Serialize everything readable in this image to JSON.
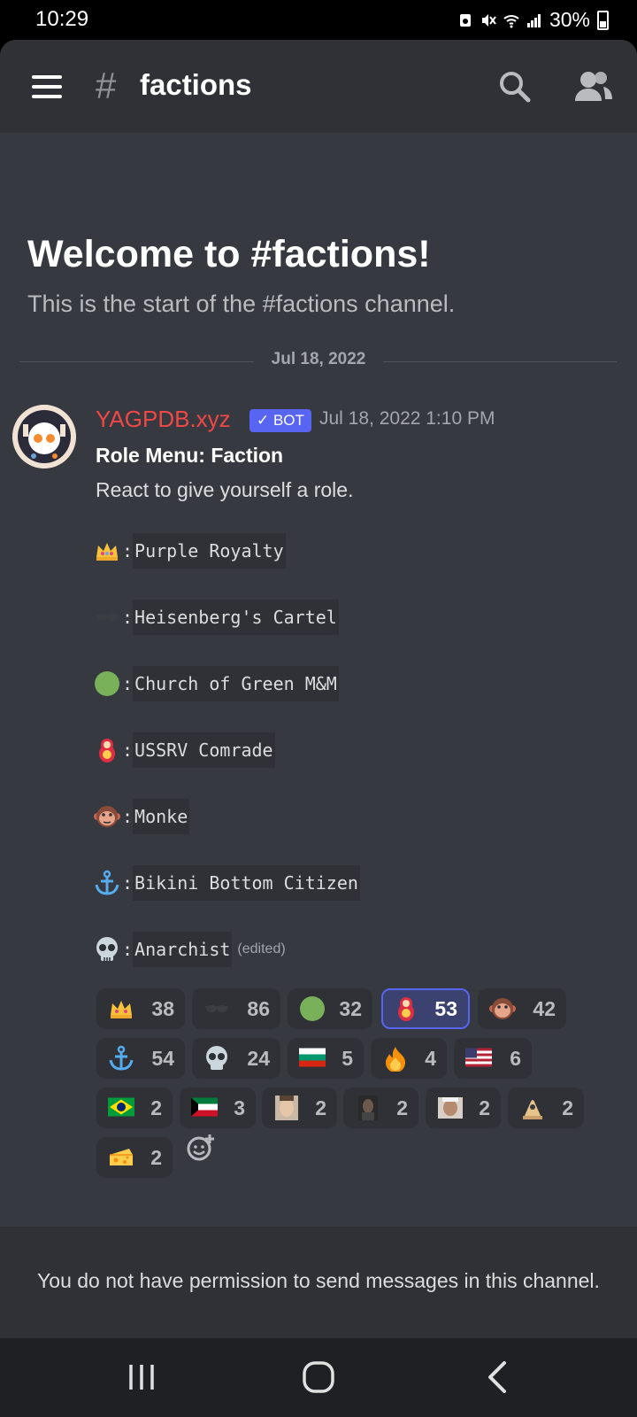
{
  "status": {
    "time": "10:29",
    "battery": "30%"
  },
  "header": {
    "hash": "#",
    "channel": "factions"
  },
  "welcome": {
    "title": "Welcome to #factions!",
    "subtitle": "This is the start of the #factions channel."
  },
  "date_divider": "Jul 18, 2022",
  "message": {
    "author": "YAGPDB.xyz",
    "bot_tag": "✓ BOT",
    "timestamp": "Jul 18, 2022 1:10 PM",
    "title": "Role Menu: Faction",
    "subtitle": "React to give yourself a role.",
    "colon": ":",
    "roles": [
      {
        "emoji": "crown-icon",
        "name": "Purple Royalty"
      },
      {
        "emoji": "sunglasses-icon",
        "name": "Heisenberg's Cartel"
      },
      {
        "emoji": "green-circle-icon",
        "name": "Church of Green M&M"
      },
      {
        "emoji": "nesting-doll-icon",
        "name": "USSRV Comrade"
      },
      {
        "emoji": "monkey-face-icon",
        "name": "Monke"
      },
      {
        "emoji": "anchor-icon",
        "name": "Bikini Bottom Citizen"
      },
      {
        "emoji": "skull-icon",
        "name": "Anarchist"
      }
    ],
    "edited": "(edited)"
  },
  "reactions": [
    {
      "emoji": "crown-icon",
      "count": "38",
      "selected": false
    },
    {
      "emoji": "sunglasses-icon",
      "count": "86",
      "selected": false
    },
    {
      "emoji": "green-circle-icon",
      "count": "32",
      "selected": false
    },
    {
      "emoji": "nesting-doll-icon",
      "count": "53",
      "selected": true
    },
    {
      "emoji": "monkey-face-icon",
      "count": "42",
      "selected": false
    },
    {
      "emoji": "anchor-icon",
      "count": "54",
      "selected": false
    },
    {
      "emoji": "skull-icon",
      "count": "24",
      "selected": false
    },
    {
      "emoji": "bulgaria-flag-icon",
      "count": "5",
      "selected": false
    },
    {
      "emoji": "fire-icon",
      "count": "4",
      "selected": false
    },
    {
      "emoji": "us-flag-icon",
      "count": "6",
      "selected": false
    },
    {
      "emoji": "brazil-flag-icon",
      "count": "2",
      "selected": false
    },
    {
      "emoji": "kuwait-flag-icon",
      "count": "3",
      "selected": false
    },
    {
      "emoji": "custom-face-emoji-1-icon",
      "count": "2",
      "selected": false
    },
    {
      "emoji": "custom-face-emoji-2-icon",
      "count": "2",
      "selected": false
    },
    {
      "emoji": "custom-face-emoji-3-icon",
      "count": "2",
      "selected": false
    },
    {
      "emoji": "custom-emoji-icon",
      "count": "2",
      "selected": false
    },
    {
      "emoji": "cheese-icon",
      "count": "2",
      "selected": false
    }
  ],
  "footer": {
    "text": "You do not have permission to send messages in this channel."
  },
  "colors": {
    "background": "#36393f",
    "header": "#2f3136",
    "blurple": "#5865f2",
    "author": "#f04747"
  }
}
